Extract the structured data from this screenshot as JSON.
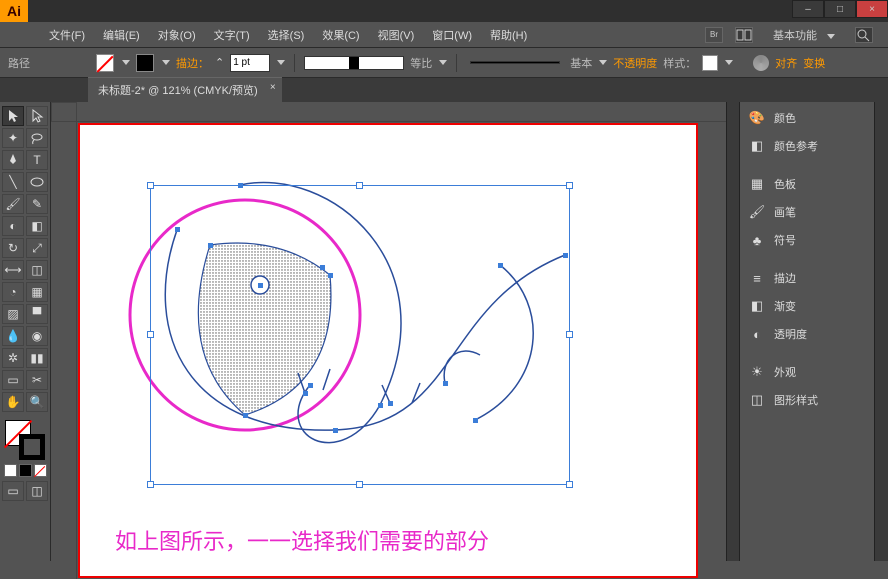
{
  "window": {
    "minimize": "–",
    "maximize": "□",
    "close": "×"
  },
  "app": {
    "logo": "Ai"
  },
  "menu": {
    "file": "文件(F)",
    "edit": "编辑(E)",
    "object": "对象(O)",
    "type": "文字(T)",
    "select": "选择(S)",
    "effect": "效果(C)",
    "view": "视图(V)",
    "window": "窗口(W)",
    "help": "帮助(H)"
  },
  "workspace": "基本功能",
  "controlbar": {
    "label": "路径",
    "stroke_lbl": "描边：",
    "weight": "1 pt",
    "profile_lbl": "等比",
    "brush_lbl": "基本",
    "opacity_lbl": "不透明度",
    "style_lbl": "样式：",
    "align_lbl": "对齐",
    "transform_lbl": "变换"
  },
  "document_tab": "未标题-2* @ 121% (CMYK/预览)",
  "panels": {
    "color": "颜色",
    "color_guide": "颜色参考",
    "swatches": "色板",
    "brushes": "画笔",
    "symbols": "符号",
    "stroke": "描边",
    "gradient": "渐变",
    "transparency": "透明度",
    "appearance": "外观",
    "graphic_styles": "图形样式"
  },
  "caption": "如上图所示，一一选择我们需要的部分"
}
